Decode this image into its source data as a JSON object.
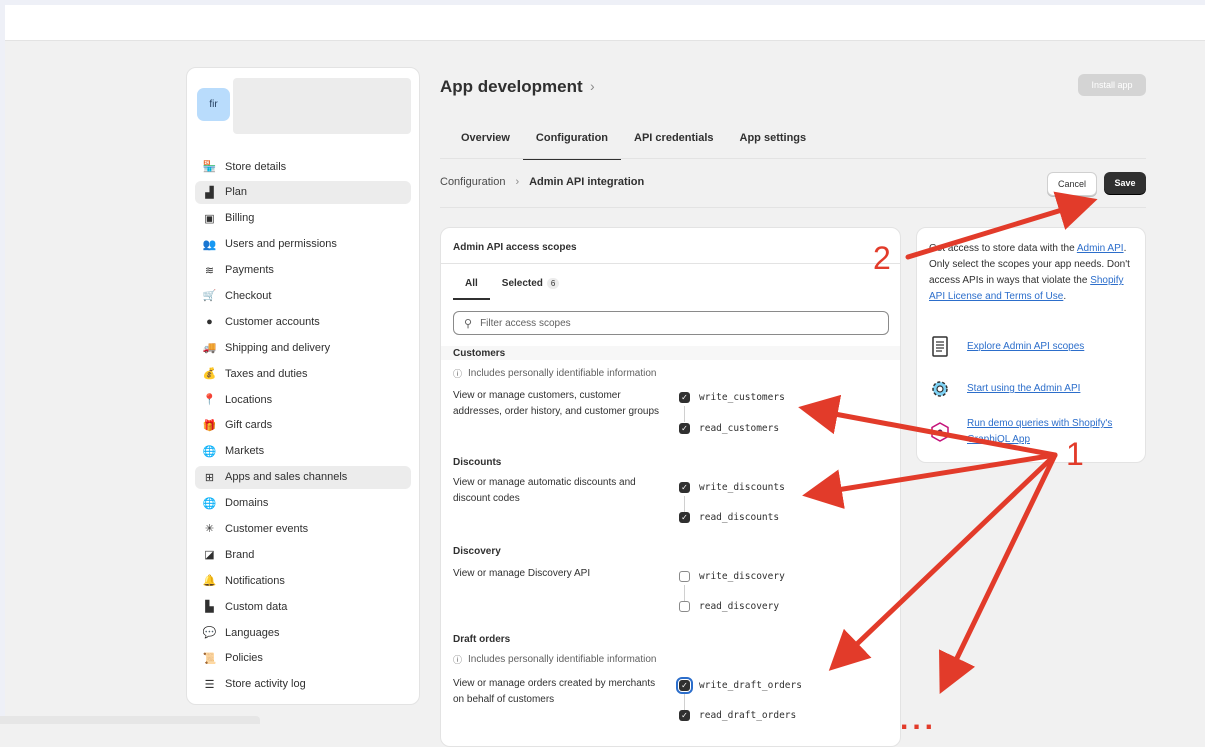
{
  "store": {
    "avatar_text": "fir"
  },
  "sidebar": {
    "items": [
      {
        "label": "Store details",
        "icon": "store-icon",
        "glyph": "🏪",
        "active": false
      },
      {
        "label": "Plan",
        "icon": "plan-icon",
        "glyph": "▟",
        "active": true
      },
      {
        "label": "Billing",
        "icon": "billing-icon",
        "glyph": "▣",
        "active": false
      },
      {
        "label": "Users and permissions",
        "icon": "users-icon",
        "glyph": "👥",
        "active": false
      },
      {
        "label": "Payments",
        "icon": "payments-icon",
        "glyph": "≋",
        "active": false
      },
      {
        "label": "Checkout",
        "icon": "cart-icon",
        "glyph": "🛒",
        "active": false
      },
      {
        "label": "Customer accounts",
        "icon": "person-icon",
        "glyph": "●",
        "active": false
      },
      {
        "label": "Shipping and delivery",
        "icon": "truck-icon",
        "glyph": "🚚",
        "active": false
      },
      {
        "label": "Taxes and duties",
        "icon": "tax-icon",
        "glyph": "💰",
        "active": false
      },
      {
        "label": "Locations",
        "icon": "location-icon",
        "glyph": "📍",
        "active": false
      },
      {
        "label": "Gift cards",
        "icon": "gift-card-icon",
        "glyph": "🎁",
        "active": false
      },
      {
        "label": "Markets",
        "icon": "globe-icon",
        "glyph": "🌐",
        "active": false
      },
      {
        "label": "Apps and sales channels",
        "icon": "apps-icon",
        "glyph": "⊞",
        "active": true
      },
      {
        "label": "Domains",
        "icon": "domain-icon",
        "glyph": "🌐",
        "active": false
      },
      {
        "label": "Customer events",
        "icon": "sparkle-icon",
        "glyph": "✳",
        "active": false
      },
      {
        "label": "Brand",
        "icon": "brand-icon",
        "glyph": "◪",
        "active": false
      },
      {
        "label": "Notifications",
        "icon": "bell-icon",
        "glyph": "🔔",
        "active": false
      },
      {
        "label": "Custom data",
        "icon": "custom-data-icon",
        "glyph": "▙",
        "active": false
      },
      {
        "label": "Languages",
        "icon": "language-icon",
        "glyph": "💬",
        "active": false
      },
      {
        "label": "Policies",
        "icon": "policy-icon",
        "glyph": "📜",
        "active": false
      },
      {
        "label": "Store activity log",
        "icon": "list-icon",
        "glyph": "☰",
        "active": false
      }
    ]
  },
  "header": {
    "title": "App development",
    "chevron": "›",
    "install_label": "Install app",
    "tabs": [
      {
        "label": "Overview",
        "active": false
      },
      {
        "label": "Configuration",
        "active": true
      },
      {
        "label": "API credentials",
        "active": false
      },
      {
        "label": "App settings",
        "active": false
      }
    ]
  },
  "breadcrumb": {
    "root": "Configuration",
    "sep": "›",
    "current": "Admin API integration",
    "cancel_label": "Cancel",
    "save_label": "Save"
  },
  "scopes": {
    "title": "Admin API access scopes",
    "tab_all": "All",
    "tab_selected": "Selected",
    "selected_count": "6",
    "filter_placeholder": "Filter access scopes",
    "pii_note": "Includes personally identifiable information",
    "groups": {
      "customers": {
        "name": "Customers",
        "description": "View or manage customers, customer addresses, order history, and customer groups",
        "write": "write_customers",
        "read": "read_customers",
        "write_checked": true,
        "read_checked": true
      },
      "discounts": {
        "name": "Discounts",
        "description": "View or manage automatic discounts and discount codes",
        "write": "write_discounts",
        "read": "read_discounts",
        "write_checked": true,
        "read_checked": true
      },
      "discovery": {
        "name": "Discovery",
        "description": "View or manage Discovery API",
        "write": "write_discovery",
        "read": "read_discovery",
        "write_checked": false,
        "read_checked": false
      },
      "draft_orders": {
        "name": "Draft orders",
        "description": "View or manage orders created by merchants on behalf of customers",
        "write": "write_draft_orders",
        "read": "read_draft_orders",
        "write_checked": true,
        "read_checked": true
      }
    }
  },
  "info": {
    "text_1": "Get access to store data with the ",
    "link_1": "Admin API",
    "text_2": ". Only select the scopes your app needs. Don't access APIs in ways that violate the ",
    "link_2": "Shopify API License and Terms of Use",
    "text_3": ".",
    "resources": [
      {
        "label": "Explore Admin API scopes",
        "icon": "document-icon"
      },
      {
        "label": "Start using the Admin API",
        "icon": "gear-icon"
      },
      {
        "label": "Run demo queries with Shopify's GraphiQL App",
        "icon": "graphql-icon"
      }
    ]
  },
  "annotations": {
    "label_1": "1",
    "label_2": "2",
    "ellipsis": "...",
    "color": "#e23b2a"
  }
}
